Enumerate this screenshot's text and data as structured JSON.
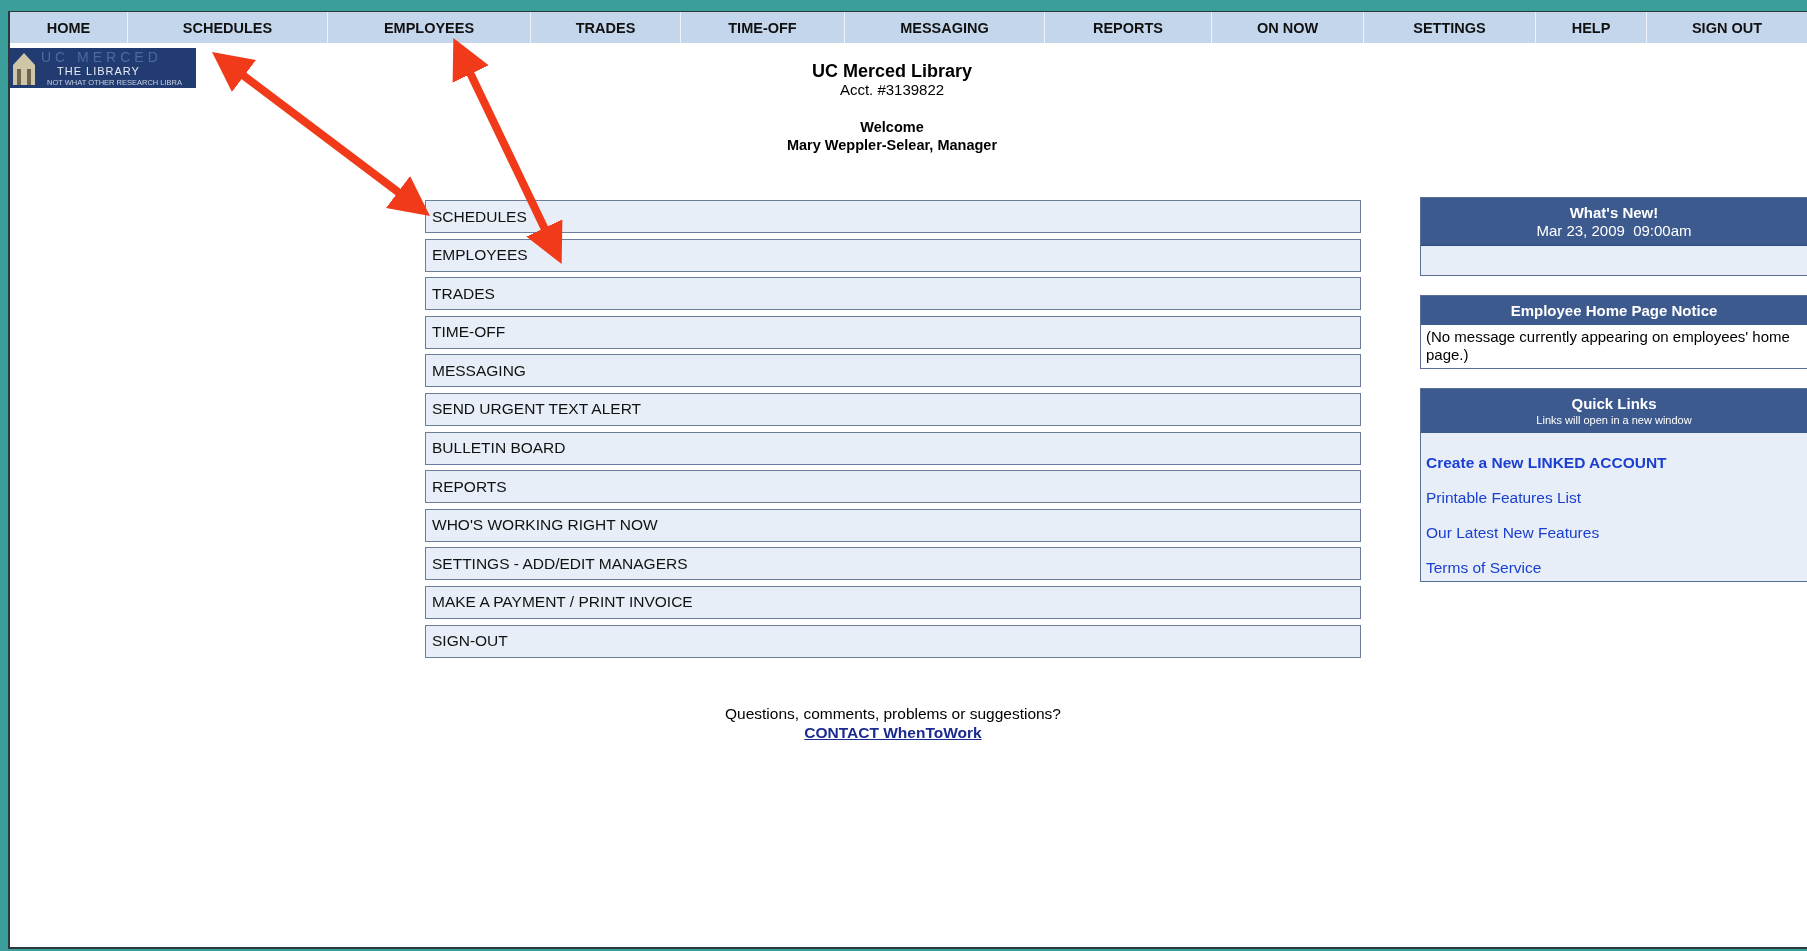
{
  "nav": [
    {
      "label": "HOME"
    },
    {
      "label": "SCHEDULES"
    },
    {
      "label": "EMPLOYEES"
    },
    {
      "label": "TRADES"
    },
    {
      "label": "TIME-OFF"
    },
    {
      "label": "MESSAGING"
    },
    {
      "label": "REPORTS"
    },
    {
      "label": "ON NOW"
    },
    {
      "label": "SETTINGS"
    },
    {
      "label": "HELP"
    },
    {
      "label": "SIGN OUT"
    }
  ],
  "logo": {
    "title": "UC MERCED",
    "subtitle": "THE LIBRARY",
    "tagline": "NOT WHAT OTHER RESEARCH LIBRA"
  },
  "header": {
    "title": "UC Merced Library",
    "account": "Acct. #3139822",
    "greeting": "Welcome",
    "user": "Mary Weppler-Selear, Manager"
  },
  "menu": [
    "SCHEDULES",
    "EMPLOYEES",
    "TRADES",
    "TIME-OFF",
    "MESSAGING",
    "SEND URGENT TEXT ALERT",
    "BULLETIN BOARD",
    "REPORTS",
    "WHO'S WORKING RIGHT NOW",
    "SETTINGS - ADD/EDIT MANAGERS",
    "MAKE A PAYMENT /  PRINT INVOICE",
    "SIGN-OUT"
  ],
  "footer": {
    "question": "Questions, comments, problems or suggestions?",
    "link": "CONTACT WhenToWork"
  },
  "panels": [
    {
      "kind": "blank",
      "title": "What's New!",
      "subtitle": "Mar 23, 2009  09:00am"
    },
    {
      "kind": "text",
      "title": "Employee Home Page Notice",
      "text": "(No message currently appearing on employees' home page.)"
    },
    {
      "kind": "links",
      "title": "Quick Links",
      "note": "Links will open in a new window",
      "links": [
        {
          "label": "Create a New LINKED ACCOUNT",
          "bold": true
        },
        {
          "label": "Printable Features List",
          "bold": false
        },
        {
          "label": "Our Latest New Features",
          "bold": false
        },
        {
          "label": "Terms of Service",
          "bold": false
        }
      ]
    }
  ]
}
